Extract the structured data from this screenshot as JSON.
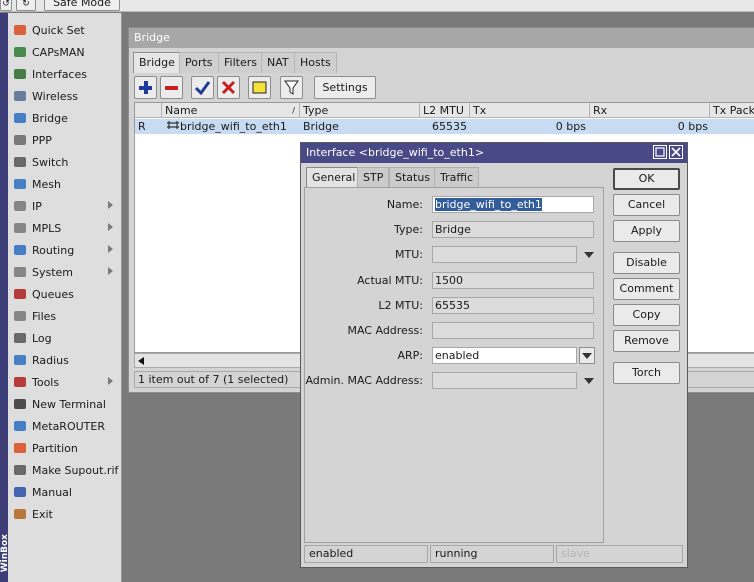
{
  "topbar": {
    "safe_mode": "Safe Mode"
  },
  "sidebar": {
    "strip_text": "WinBox",
    "items": [
      {
        "label": "Quick Set",
        "icon": "quick-set-icon",
        "submenu": false
      },
      {
        "label": "CAPsMAN",
        "icon": "capsman-icon",
        "submenu": false
      },
      {
        "label": "Interfaces",
        "icon": "interfaces-icon",
        "submenu": false
      },
      {
        "label": "Wireless",
        "icon": "wireless-icon",
        "submenu": false
      },
      {
        "label": "Bridge",
        "icon": "bridge-icon",
        "submenu": false
      },
      {
        "label": "PPP",
        "icon": "ppp-icon",
        "submenu": false
      },
      {
        "label": "Switch",
        "icon": "switch-icon",
        "submenu": false
      },
      {
        "label": "Mesh",
        "icon": "mesh-icon",
        "submenu": false
      },
      {
        "label": "IP",
        "icon": "ip-icon",
        "submenu": true
      },
      {
        "label": "MPLS",
        "icon": "mpls-icon",
        "submenu": true
      },
      {
        "label": "Routing",
        "icon": "routing-icon",
        "submenu": true
      },
      {
        "label": "System",
        "icon": "system-icon",
        "submenu": true
      },
      {
        "label": "Queues",
        "icon": "queues-icon",
        "submenu": false
      },
      {
        "label": "Files",
        "icon": "files-icon",
        "submenu": false
      },
      {
        "label": "Log",
        "icon": "log-icon",
        "submenu": false
      },
      {
        "label": "Radius",
        "icon": "radius-icon",
        "submenu": false
      },
      {
        "label": "Tools",
        "icon": "tools-icon",
        "submenu": true
      },
      {
        "label": "New Terminal",
        "icon": "terminal-icon",
        "submenu": false
      },
      {
        "label": "MetaROUTER",
        "icon": "metarouter-icon",
        "submenu": false
      },
      {
        "label": "Partition",
        "icon": "partition-icon",
        "submenu": false
      },
      {
        "label": "Make Supout.rif",
        "icon": "supout-icon",
        "submenu": false
      },
      {
        "label": "Manual",
        "icon": "manual-icon",
        "submenu": false
      },
      {
        "label": "Exit",
        "icon": "exit-icon",
        "submenu": false
      }
    ]
  },
  "bridge_window": {
    "title": "Bridge",
    "tabs": [
      "Bridge",
      "Ports",
      "Filters",
      "NAT",
      "Hosts"
    ],
    "settings_label": "Settings",
    "columns": [
      "Name",
      "Type",
      "L2 MTU",
      "Tx",
      "Rx",
      "Tx Packet"
    ],
    "rows": [
      {
        "flag": "R",
        "name": "bridge_wifi_to_eth1",
        "type": "Bridge",
        "l2mtu": "65535",
        "tx": "0 bps",
        "rx": "0 bps"
      }
    ],
    "status": "1 item out of 7 (1 selected)"
  },
  "dialog": {
    "title": "Interface <bridge_wifi_to_eth1>",
    "tabs": [
      "General",
      "STP",
      "Status",
      "Traffic"
    ],
    "fields": {
      "name_label": "Name:",
      "name_value": "bridge_wifi_to_eth1",
      "type_label": "Type:",
      "type_value": "Bridge",
      "mtu_label": "MTU:",
      "mtu_value": "",
      "actual_mtu_label": "Actual MTU:",
      "actual_mtu_value": "1500",
      "l2mtu_label": "L2 MTU:",
      "l2mtu_value": "65535",
      "mac_label": "MAC Address:",
      "mac_value": "",
      "arp_label": "ARP:",
      "arp_value": "enabled",
      "admin_mac_label": "Admin. MAC Address:",
      "admin_mac_value": ""
    },
    "buttons": [
      "OK",
      "Cancel",
      "Apply",
      "Disable",
      "Comment",
      "Copy",
      "Remove",
      "Torch"
    ],
    "status": [
      "enabled",
      "running",
      "slave"
    ]
  },
  "colors": {
    "dialog_title_bg": "#494987",
    "selected_row": "#c7dcf3",
    "sidebar_strip": "#3d3d77"
  }
}
